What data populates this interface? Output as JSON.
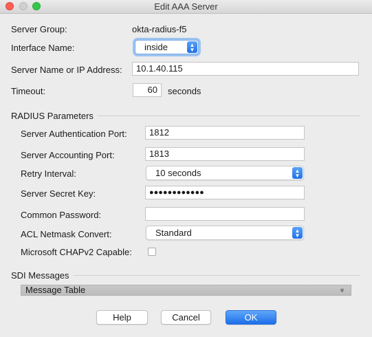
{
  "window": {
    "title": "Edit AAA Server"
  },
  "form": {
    "server_group_label": "Server Group:",
    "server_group_value": "okta-radius-f5",
    "interface_label": "Interface Name:",
    "interface_value": "inside",
    "server_name_label": "Server Name or IP Address:",
    "server_name_value": "10.1.40.115",
    "timeout_label": "Timeout:",
    "timeout_value": "60",
    "timeout_unit": "seconds"
  },
  "radius": {
    "section_title": "RADIUS Parameters",
    "auth_port_label": "Server Authentication Port:",
    "auth_port_value": "1812",
    "acct_port_label": "Server Accounting Port:",
    "acct_port_value": "1813",
    "retry_label": "Retry Interval:",
    "retry_value": "10 seconds",
    "secret_label": "Server Secret Key:",
    "secret_value": "●●●●●●●●●●●●",
    "common_pw_label": "Common Password:",
    "common_pw_value": "",
    "acl_label": "ACL Netmask Convert:",
    "acl_value": "Standard",
    "chap_label": "Microsoft CHAPv2 Capable:",
    "chap_checked": false
  },
  "sdi": {
    "section_title": "SDI Messages",
    "table_label": "Message Table",
    "expand_glyph": "»"
  },
  "buttons": {
    "help": "Help",
    "cancel": "Cancel",
    "ok": "OK"
  },
  "glyphs": {
    "up": "▲",
    "down": "▼"
  }
}
